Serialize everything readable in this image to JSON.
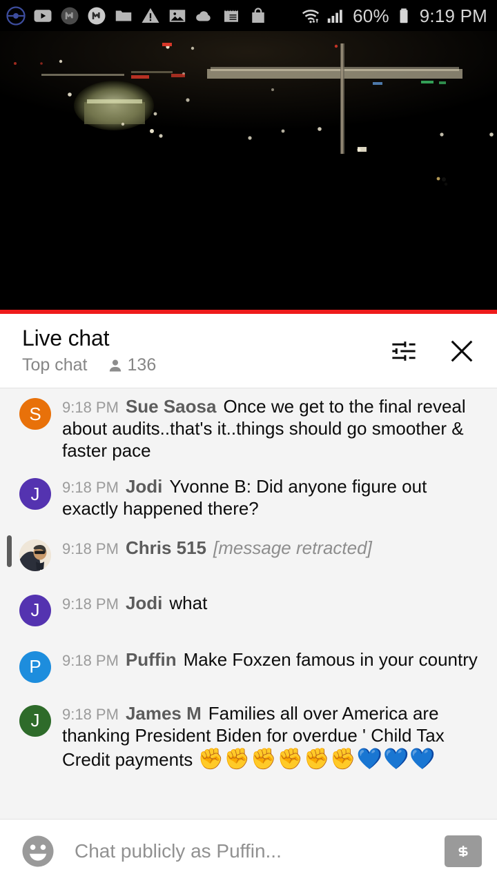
{
  "status_bar": {
    "left_icons": [
      {
        "name": "pokemon-go-icon",
        "label": "Pokemon Go"
      },
      {
        "name": "youtube-icon",
        "label": "YouTube"
      },
      {
        "name": "messenger-dark-icon",
        "label": "Messenger"
      },
      {
        "name": "messenger-icon",
        "label": "Messenger"
      },
      {
        "name": "folder-icon",
        "label": "Folder"
      },
      {
        "name": "warning-icon",
        "label": "Warning"
      },
      {
        "name": "image-icon",
        "label": "Photos"
      },
      {
        "name": "cloud-icon",
        "label": "Cloud"
      },
      {
        "name": "notepad-icon",
        "label": "Notes"
      },
      {
        "name": "shopping-bag-icon",
        "label": "Shopping"
      }
    ],
    "wifi_icon": "wifi-icon",
    "signal_icon": "cellular-signal-icon",
    "battery_percent": "60%",
    "battery_icon": "battery-icon",
    "time": "9:19 PM"
  },
  "video": {
    "alt": "Night cityscape live stream",
    "progress_percent": 100,
    "progress_color": "#ee1b1b"
  },
  "chat_header": {
    "title": "Live chat",
    "mode": "Top chat",
    "viewer_count": "136",
    "viewer_icon": "person-icon",
    "settings_icon": "tune-sliders-icon",
    "close_icon": "close-icon"
  },
  "messages": [
    {
      "id": "msg-sue-saosa",
      "timestamp": "9:18 PM",
      "author": "Sue Saosa",
      "text": "Once we get to the final reveal about audits..that's it..things should go smoother & faster pace",
      "avatar_type": "initial",
      "avatar_initial": "S",
      "avatar_color": "#e8710a",
      "retracted": false,
      "marker": false
    },
    {
      "id": "msg-jodi-1",
      "timestamp": "9:18 PM",
      "author": "Jodi",
      "text": "Yvonne B: Did anyone figure out exactly happened there?",
      "avatar_type": "initial",
      "avatar_initial": "J",
      "avatar_color": "#5433b0",
      "retracted": false,
      "marker": false
    },
    {
      "id": "msg-chris-515",
      "timestamp": "9:18 PM",
      "author": "Chris 515",
      "text": "[message retracted]",
      "avatar_type": "photo",
      "avatar_initial": "",
      "avatar_color": "#efe6d8",
      "retracted": true,
      "marker": true
    },
    {
      "id": "msg-jodi-2",
      "timestamp": "9:18 PM",
      "author": "Jodi",
      "text": "what",
      "avatar_type": "initial",
      "avatar_initial": "J",
      "avatar_color": "#5433b0",
      "retracted": false,
      "marker": false
    },
    {
      "id": "msg-puffin",
      "timestamp": "9:18 PM",
      "author": "Puffin",
      "text": "Make Foxzen famous in your country",
      "avatar_type": "initial",
      "avatar_initial": "P",
      "avatar_color": "#1d8ddd",
      "retracted": false,
      "marker": false
    },
    {
      "id": "msg-james-m",
      "timestamp": "9:18 PM",
      "author": "James M",
      "text": "Families all over America are thanking President Biden for overdue ' Child Tax Credit payments ",
      "emojis": "✊✊✊✊✊✊💙💙💙",
      "avatar_type": "initial",
      "avatar_initial": "J",
      "avatar_color": "#2e6b2a",
      "retracted": false,
      "marker": false
    }
  ],
  "input_bar": {
    "emoji_icon": "emoji-face-icon",
    "placeholder": "Chat publicly as Puffin...",
    "value": "",
    "superchat_icon": "super-chat-dollar-icon"
  }
}
